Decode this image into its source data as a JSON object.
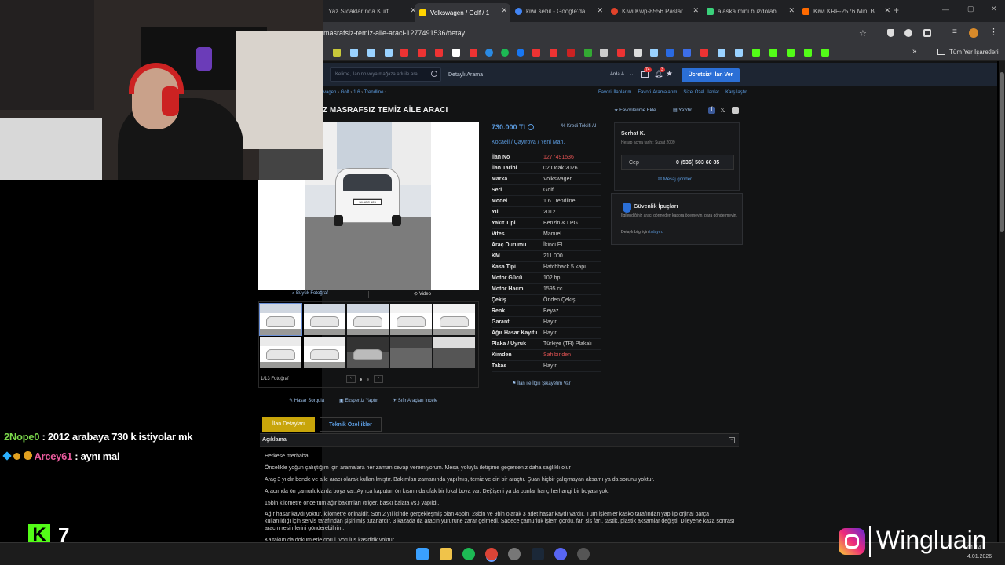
{
  "tabs": [
    {
      "label": "Yaz Sıcaklarında Kurt",
      "color": "#888"
    },
    {
      "label": "Volkswagen / Golf / 1",
      "color": "#ffd400"
    },
    {
      "label": "kiwi sebil - Google'da",
      "color": "#4285f4"
    },
    {
      "label": "Kiwi Kwp-8556 Paslar",
      "color": "#e1422a"
    },
    {
      "label": "alaska mini buzdolab",
      "color": "#3ad17b"
    },
    {
      "label": "Kiwi KRF-2576 Mini B",
      "color": "#ff6a00"
    }
  ],
  "url": "masrafsiz-temiz-aile-araci-1277491536/detay",
  "bookmarks_all": "Tüm Yer İşaretleri",
  "site": {
    "search_placeholder": "Kelime, ilan no veya mağaza adı ile ara",
    "advanced": "Detaylı Arama",
    "user": "Arda A.",
    "badge1": "74",
    "badge2": "3",
    "post_button": "Ücretsiz* İlan Ver"
  },
  "breadcrumbs": [
    "vagen",
    "Golf",
    "1.6",
    "Trendline"
  ],
  "top_links": [
    "Favori İlanlarım",
    "Favori Aramalarım",
    "Size Özel İlanlar",
    "Karşılaştır"
  ],
  "title": "Z MASRAFSIZ TEMİZ AİLE ARACI",
  "fav_add": "Favorilerime Ekle",
  "print": "Yazdır",
  "price": "730.000 TL",
  "loan": "Kredi Teklifi Al",
  "location": "Kocaeli  /  Çayırova  /  Yeni Mah.",
  "specs": [
    {
      "k": "İlan No",
      "v": "1277491536"
    },
    {
      "k": "İlan Tarihi",
      "v": "02 Ocak 2026"
    },
    {
      "k": "Marka",
      "v": "Volkswagen"
    },
    {
      "k": "Seri",
      "v": "Golf"
    },
    {
      "k": "Model",
      "v": "1.6 Trendline"
    },
    {
      "k": "Yıl",
      "v": "2012"
    },
    {
      "k": "Yakıt Tipi",
      "v": "Benzin & LPG"
    },
    {
      "k": "Vites",
      "v": "Manuel"
    },
    {
      "k": "Araç Durumu",
      "v": "İkinci El"
    },
    {
      "k": "KM",
      "v": "211.000"
    },
    {
      "k": "Kasa Tipi",
      "v": "Hatchback 5 kapı"
    },
    {
      "k": "Motor Gücü",
      "v": "102 hp"
    },
    {
      "k": "Motor Hacmi",
      "v": "1595 cc"
    },
    {
      "k": "Çekiş",
      "v": "Önden Çekiş"
    },
    {
      "k": "Renk",
      "v": "Beyaz"
    },
    {
      "k": "Garanti",
      "v": "Hayır"
    },
    {
      "k": "Ağır Hasar Kayıtlı",
      "v": "Hayır"
    },
    {
      "k": "Plaka / Uyruk",
      "v": "Türkiye (TR) Plakalı"
    },
    {
      "k": "Kimden",
      "v": "Sahibinden"
    },
    {
      "k": "Takas",
      "v": "Hayır"
    }
  ],
  "report": "İlan ile İlgili Şikayetim Var",
  "seller": {
    "name": "Serhat K.",
    "since": "Hesap açma tarihi: Şubat 2009",
    "phone_label": "Cep",
    "phone": "0 (536) 503 60 85",
    "message": "Mesaj gönder"
  },
  "safety": {
    "title": "Güvenlik İpuçları",
    "text": "İlgilendiğiniz aracı görmeden kapora ödemeyin, para göndermeyin.",
    "more": "Detaylı bilgi için",
    "more_link": "tıklayın."
  },
  "photo_buttons": {
    "big": "Büyük Fotoğraf",
    "video": "Video"
  },
  "photo_count": "1/13 Fotoğraf",
  "plate": "34 ABC 123",
  "tools": [
    "Hasar Sorgula",
    "Ekspertiz Yaptır",
    "Sıfır Araçları İncele"
  ],
  "detail_tabs": [
    "İlan Detayları",
    "Teknik Özellikler"
  ],
  "desc_header": "Açıklama",
  "desc": [
    "Herkese merhaba,",
    "Öncelikle yoğun çalıştığım için aramalara her zaman cevap veremiyorum. Mesaj yoluyla iletişime geçerseniz daha sağlıklı olur",
    "Araç 3 yıldır bende ve aile aracı olarak kullanılmıştır. Bakımları zamanında yapılmış, temiz ve diri bir araçtır. Şuan hiçbir çalışmayan aksamı ya da sorunu yoktur.",
    "Aracımda ön çamurluklarda boya var. Ayrıca kaputun ön kısmında ufak bir lokal boya var. Değişeni ya da bunlar hariç herhangi bir boyası yok.",
    "15bin kilometre önce tüm ağır bakımları (triger, baskı balata vs.) yapıldı.",
    "Ağır hasar kaydı yoktur, kilometre orjinaldir. Son 2 yıl içinde gerçekleşmiş olan 45bin, 28bin ve 9bin olarak 3 adet hasar kaydı vardır. Tüm işlemler kasko tarafından yapılıp orjinal parça kullanıldığı için servis tarafından şişirilmiş tutarlardır. 3 kazada da aracın yürürüne zarar gelmedi. Sadece çamurluk işlem gördü, far, sis farı, tastik, plastik aksamlar değişti. Dileyene kaza sonrası aracın resimlerini gönderebilirim.",
    "Kaltakun da dökümlerle görül. yoruluş kaşiditik yoktur"
  ],
  "chat": [
    {
      "user": "2Nope0",
      "msg": "2012 arabaya 730 k istiyolar mk",
      "color": "#7bd84b"
    },
    {
      "user": "Arcey61",
      "msg": "aynı mal",
      "color": "#e95b9d"
    }
  ],
  "kick_count": "7",
  "watermark": "Wingluain",
  "clock": {
    "time": "01:14",
    "date": "4.01.2026"
  }
}
